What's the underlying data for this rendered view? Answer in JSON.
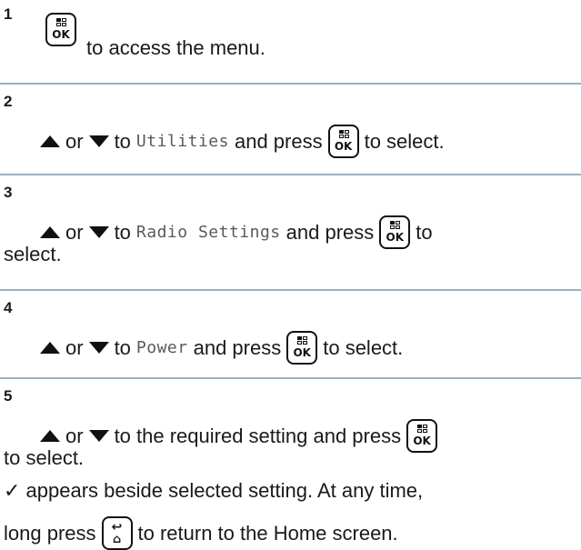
{
  "steps": [
    {
      "number": "1",
      "text1": "to access the menu."
    },
    {
      "number": "2",
      "or": "or",
      "to": "to",
      "menu_item": "Utilities",
      "and_press": "and press",
      "text_end": "to select."
    },
    {
      "number": "3",
      "or": "or",
      "to": "to",
      "menu_item": "Radio Settings",
      "and_press": "and press",
      "text_end": "to",
      "text_line2": "select."
    },
    {
      "number": "4",
      "or": "or",
      "to": "to",
      "menu_item": "Power",
      "and_press": "and press",
      "text_end": "to select."
    },
    {
      "number": "5",
      "or": "or",
      "text_mid": "to the required setting and press",
      "text_line2": "to select.",
      "note": "✓ appears beside selected setting. At any time,",
      "long_press": "long press",
      "text_last": "to return to the Home screen."
    }
  ],
  "key_labels": {
    "ok": "OK",
    "back": "↩",
    "home": "⌂"
  },
  "colors": {
    "divider": "#9bb1c2",
    "menu_text": "#5a5a5a"
  },
  "icons": [
    "menu-ok-key-icon",
    "up-arrow-icon",
    "down-arrow-icon",
    "back-home-key-icon"
  ]
}
